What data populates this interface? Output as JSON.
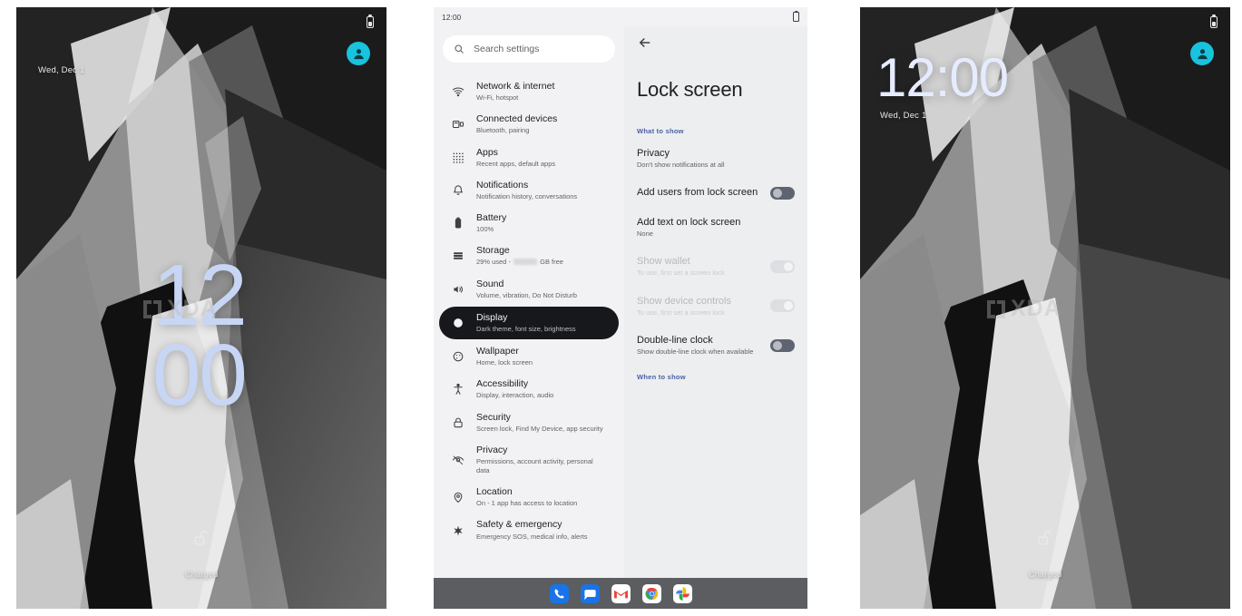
{
  "lock_screen": {
    "status_battery_icon": "battery-icon",
    "avatar_icon": "user-avatar-icon",
    "date": "Wed, Dec 1",
    "clock_double_line_1": "12",
    "clock_double_line_2": "00",
    "clock_single": "12:00",
    "lock_icon": "unlocked-padlock-icon",
    "battery_status": "Charged",
    "watermark": "XDA"
  },
  "settings": {
    "status_time": "12:00",
    "status_battery_icon": "battery-icon",
    "search": {
      "placeholder": "Search settings",
      "icon": "search-icon"
    },
    "items": [
      {
        "icon": "wifi-icon",
        "title": "Network & internet",
        "subtitle": "Wi-Fi, hotspot",
        "active": false
      },
      {
        "icon": "devices-icon",
        "title": "Connected devices",
        "subtitle": "Bluetooth, pairing",
        "active": false
      },
      {
        "icon": "apps-grid-icon",
        "title": "Apps",
        "subtitle": "Recent apps, default apps",
        "active": false
      },
      {
        "icon": "bell-icon",
        "title": "Notifications",
        "subtitle": "Notification history, conversations",
        "active": false
      },
      {
        "icon": "battery-icon",
        "title": "Battery",
        "subtitle": "100%",
        "active": false
      },
      {
        "icon": "storage-icon",
        "title": "Storage",
        "subtitle_pre": "29% used - ",
        "subtitle_post": " GB free",
        "redacted": true,
        "active": false
      },
      {
        "icon": "sound-icon",
        "title": "Sound",
        "subtitle": "Volume, vibration, Do Not Disturb",
        "active": false
      },
      {
        "icon": "display-icon",
        "title": "Display",
        "subtitle": "Dark theme, font size, brightness",
        "active": true
      },
      {
        "icon": "wallpaper-icon",
        "title": "Wallpaper",
        "subtitle": "Home, lock screen",
        "active": false
      },
      {
        "icon": "accessibility-icon",
        "title": "Accessibility",
        "subtitle": "Display, interaction, audio",
        "active": false
      },
      {
        "icon": "lock-icon",
        "title": "Security",
        "subtitle": "Screen lock, Find My Device, app security",
        "active": false
      },
      {
        "icon": "privacy-eye-icon",
        "title": "Privacy",
        "subtitle": "Permissions, account activity, personal data",
        "active": false
      },
      {
        "icon": "location-pin-icon",
        "title": "Location",
        "subtitle": "On - 1 app has access to location",
        "active": false
      },
      {
        "icon": "emergency-icon",
        "title": "Safety & emergency",
        "subtitle": "Emergency SOS, medical info, alerts",
        "active": false
      }
    ]
  },
  "detail": {
    "back_icon": "back-arrow-icon",
    "title": "Lock screen",
    "section_what_to_show": "What to show",
    "section_when_to_show": "When to show",
    "rows": [
      {
        "title": "Privacy",
        "subtitle": "Don't show notifications at all",
        "toggle": false,
        "disabled": false
      },
      {
        "title": "Add users from lock screen",
        "subtitle": "",
        "toggle": true,
        "toggle_on": false,
        "disabled": false
      },
      {
        "title": "Add text on lock screen",
        "subtitle": "None",
        "toggle": false,
        "disabled": false
      },
      {
        "title": "Show wallet",
        "subtitle": "To use, first set a screen lock",
        "toggle": true,
        "toggle_on": false,
        "disabled": true
      },
      {
        "title": "Show device controls",
        "subtitle": "To use, first set a screen lock",
        "toggle": true,
        "toggle_on": false,
        "disabled": true
      },
      {
        "title": "Double-line clock",
        "subtitle": "Show double-line clock when available",
        "toggle": true,
        "toggle_on": false,
        "disabled": false
      }
    ]
  },
  "taskbar": {
    "apps": [
      {
        "name": "phone-app-icon",
        "label": ""
      },
      {
        "name": "messages-app-icon",
        "label": ""
      },
      {
        "name": "gmail-app-icon",
        "label": "M"
      },
      {
        "name": "chrome-app-icon",
        "label": ""
      },
      {
        "name": "photos-app-icon",
        "label": ""
      }
    ]
  },
  "colors": {
    "accent_avatar": "#17c3dd",
    "active_row_bg": "#16181b",
    "section_label": "#4a5fa5",
    "taskbar_bg": "#5b5d60"
  }
}
